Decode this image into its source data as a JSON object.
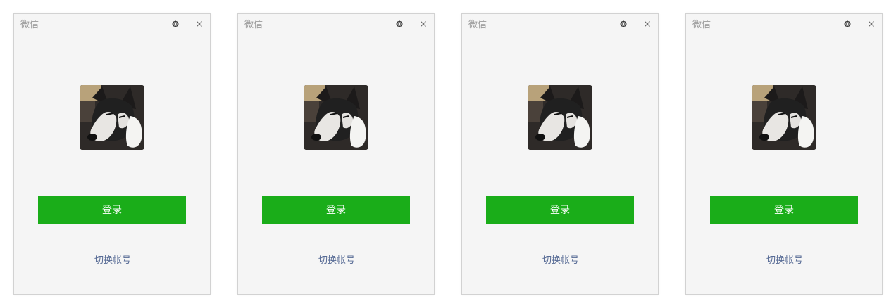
{
  "windows": [
    {
      "title": "微信",
      "settings_icon": "gear-icon",
      "close_icon": "close-icon",
      "avatar": "husky-dog-avatar",
      "nickname": "",
      "login_label": "登录",
      "switch_account_label": "切换帐号"
    },
    {
      "title": "微信",
      "settings_icon": "gear-icon",
      "close_icon": "close-icon",
      "avatar": "husky-dog-avatar",
      "nickname": "",
      "login_label": "登录",
      "switch_account_label": "切换帐号"
    },
    {
      "title": "微信",
      "settings_icon": "gear-icon",
      "close_icon": "close-icon",
      "avatar": "husky-dog-avatar",
      "nickname": "",
      "login_label": "登录",
      "switch_account_label": "切换帐号"
    },
    {
      "title": "微信",
      "settings_icon": "gear-icon",
      "close_icon": "close-icon",
      "avatar": "husky-dog-avatar",
      "nickname": "",
      "login_label": "登录",
      "switch_account_label": "切换帐号"
    }
  ],
  "colors": {
    "login_button": "#1aad19",
    "link": "#576b95",
    "title": "#9b9b9b",
    "window_bg": "#f5f5f5"
  }
}
